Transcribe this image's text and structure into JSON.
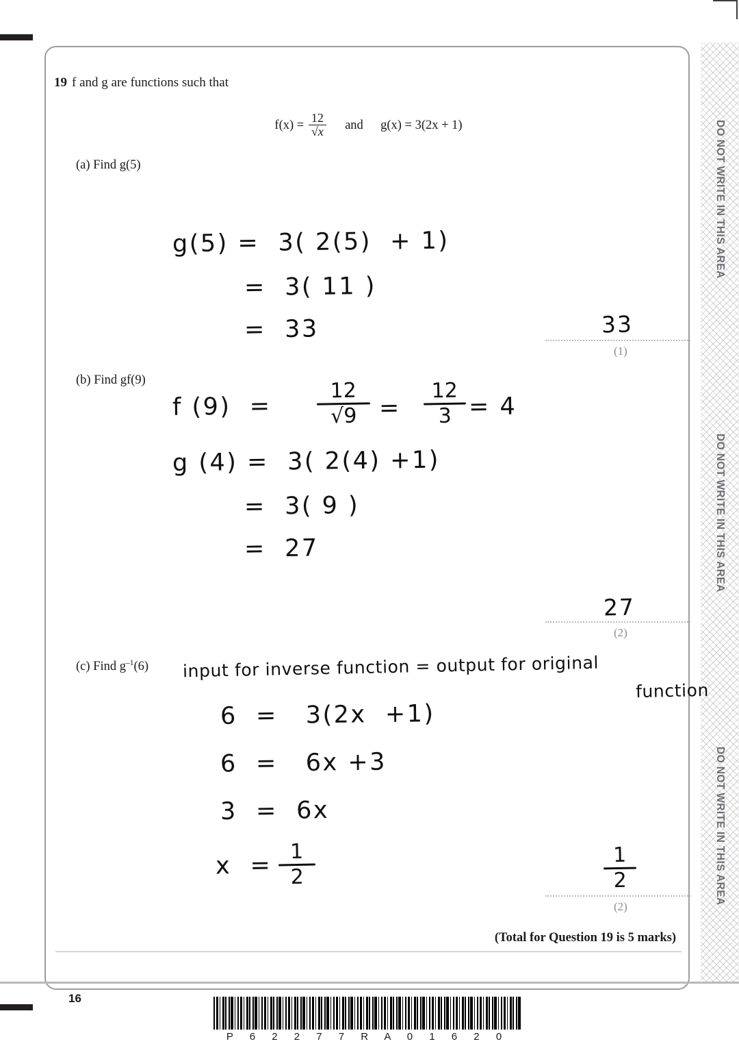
{
  "document": {
    "page_number": "16",
    "barcode_text": "P 6 2 2 7 7 R A 0 1 6 2 0",
    "side_notice": "DO NOT WRITE IN THIS AREA",
    "side_notice_repeats": 3
  },
  "question": {
    "number": "19",
    "stem": "f and g are functions such that",
    "formula": {
      "f_label": "f(x) =",
      "f_numerator": "12",
      "f_denominator": "√x",
      "conjunction": "and",
      "g_definition": "g(x) = 3(2x + 1)"
    },
    "total_text": "(Total for Question 19 is 5 marks)"
  },
  "parts": [
    {
      "label": "(a)  Find g(5)",
      "marks": "(1)",
      "answer": "33",
      "working": [
        "g(5) =  3( 2(5)  + 1)",
        "=  3( 11 )",
        "=  33"
      ]
    },
    {
      "label": "(b)  Find gf(9)",
      "marks": "(2)",
      "answer": "27",
      "working": [
        "f (9)  =",
        "12",
        "√9",
        "=",
        "12",
        "3",
        "= 4",
        "g (4) =  3( 2(4) +1)",
        "=  3( 9 )",
        "=  27"
      ]
    },
    {
      "label_prefix": "(c)  Find g",
      "label_sup": "–1",
      "label_suffix": "(6)",
      "marks": "(2)",
      "answer_numerator": "1",
      "answer_denominator": "2",
      "note_line1": "input for inverse function = output for original",
      "note_line2": "function",
      "working": [
        "6  =   3(2x  +1)",
        "6  =   6x +3",
        "3  =  6x",
        "x  =",
        "1",
        "2"
      ]
    }
  ],
  "colors": {
    "box_border": "#9c9c9c",
    "dotted_line": "#b9b9bd",
    "marks_text": "#8e8e93",
    "side_notice_text": "#6e6e73",
    "ink": "#101010"
  }
}
